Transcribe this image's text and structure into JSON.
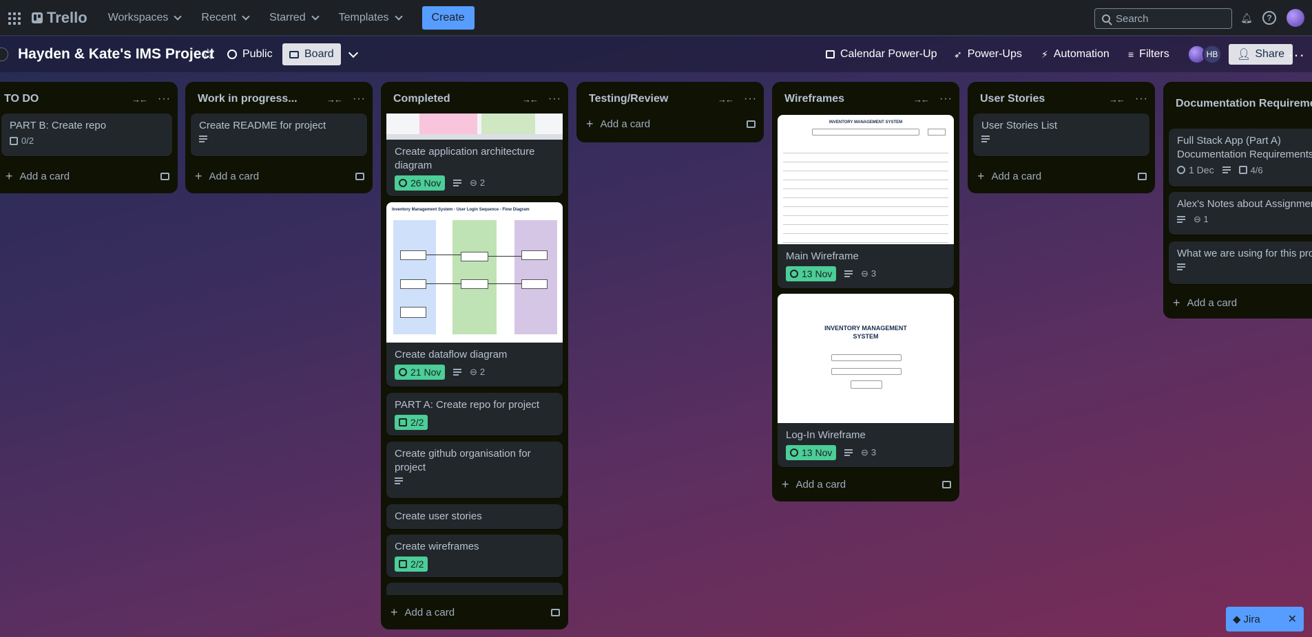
{
  "topnav": {
    "logo": "Trello",
    "menus": [
      "Workspaces",
      "Recent",
      "Starred",
      "Templates"
    ],
    "create_label": "Create",
    "search_placeholder": "Search"
  },
  "board": {
    "title": "Hayden & Kate's IMS Project",
    "visibility": "Public",
    "view": "Board",
    "calendar": "Calendar Power-Up",
    "powerups": "Power-Ups",
    "automation": "Automation",
    "filters": "Filters",
    "member_initials": "HB",
    "share": "Share"
  },
  "lists": {
    "todo": {
      "title": "TO DO",
      "cards": [
        {
          "title": "PART B: Create repo",
          "checklist": "0/2"
        }
      ],
      "add": "Add a card"
    },
    "wip": {
      "title": "Work in progress...",
      "cards": [
        {
          "title": "Create README for project"
        }
      ],
      "add": "Add a card"
    },
    "completed": {
      "title": "Completed",
      "cards": [
        {
          "title": "Create application architecture diagram",
          "date": "26 Nov",
          "attachments": "2"
        },
        {
          "title": "Create dataflow diagram",
          "date": "21 Nov",
          "attachments": "2",
          "cover_title": "Inventory Management System - User Login Sequence - Flow Diagram"
        },
        {
          "title": "PART A: Create repo for project",
          "checklist": "2/2"
        },
        {
          "title": "Create github organisation for project"
        },
        {
          "title": "Create user stories"
        },
        {
          "title": "Create wireframes",
          "checklist": "2/2"
        }
      ],
      "add": "Add a card"
    },
    "testing": {
      "title": "Testing/Review",
      "add": "Add a card"
    },
    "wireframes": {
      "title": "Wireframes",
      "cards": [
        {
          "title": "Main Wireframe",
          "date": "13 Nov",
          "attachments": "3",
          "cover_title": "INVENTORY MANAGEMENT SYSTEM"
        },
        {
          "title": "Log-In Wireframe",
          "date": "13 Nov",
          "attachments": "3",
          "cover_title": "INVENTORY MANAGEMENT SYSTEM"
        }
      ],
      "add": "Add a card"
    },
    "stories": {
      "title": "User Stories",
      "cards": [
        {
          "title": "User Stories List"
        }
      ],
      "add": "Add a card"
    },
    "docs": {
      "title": "Documentation Requirements",
      "cards": [
        {
          "title": "Full Stack App (Part A) Documentation Requirements",
          "date": "1 Dec",
          "checklist": "4/6"
        },
        {
          "title": "Alex's Notes about Assignment",
          "attachments": "1"
        },
        {
          "title": "What we are using for this project"
        }
      ],
      "add": "Add a card"
    }
  },
  "jira": {
    "label": "Jira"
  },
  "colors": {
    "accent": "#579dff",
    "date_done": "#4bce97",
    "list_bg": "#101204",
    "card_bg": "#22272b"
  }
}
